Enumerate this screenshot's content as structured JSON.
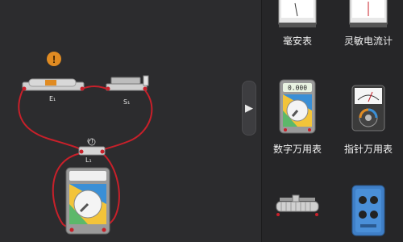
{
  "circuit": {
    "battery_label": "E₁",
    "switch_label": "S₁",
    "bulb_label": "L₁",
    "bulb_display": "(·)",
    "multimeter_display": ""
  },
  "palette": {
    "items": [
      {
        "label": "毫安表",
        "icon": "milliammeter-icon"
      },
      {
        "label": "灵敏电流计",
        "icon": "galvanometer-icon"
      },
      {
        "label": "数字万用表",
        "icon": "digital-multimeter-icon",
        "display": "0.000"
      },
      {
        "label": "指针万用表",
        "icon": "analog-multimeter-icon"
      },
      {
        "label": "",
        "icon": "rheostat-icon"
      },
      {
        "label": "",
        "icon": "signal-generator-icon"
      }
    ]
  },
  "colors": {
    "wire": "#c8202a",
    "accent": "#e08b22",
    "background": "#2c2c2e"
  }
}
